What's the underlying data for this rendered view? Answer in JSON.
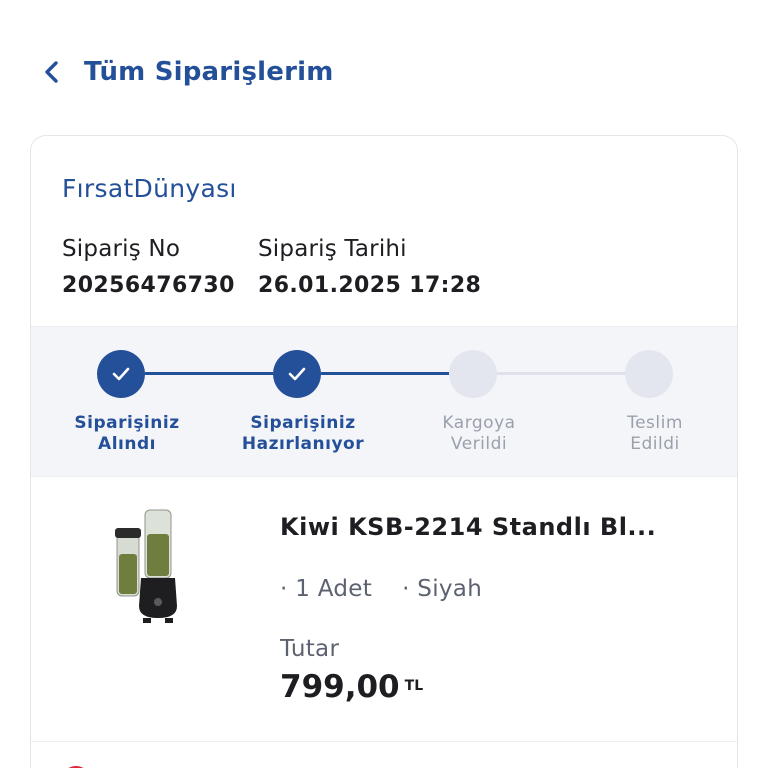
{
  "header": {
    "back_icon": "chevron-left-icon",
    "title": "Tüm Siparişlerim"
  },
  "order": {
    "seller": "FırsatDünyası",
    "number_label": "Sipariş No",
    "number_value": "20256476730",
    "date_label": "Sipariş Tarihi",
    "date_value": "26.01.2025 17:28"
  },
  "steps": [
    {
      "line1": "Siparişiniz",
      "line2": "Alındı",
      "status": "done"
    },
    {
      "line1": "Siparişiniz",
      "line2": "Hazırlanıyor",
      "status": "done"
    },
    {
      "line1": "Kargoya",
      "line2": "Verildi",
      "status": "pending"
    },
    {
      "line1": "Teslim",
      "line2": "Edildi",
      "status": "pending"
    }
  ],
  "product": {
    "title": "Kiwi KSB-2214 Standlı Bl...",
    "quantity": "· 1 Adet",
    "color": "· Siyah",
    "total_label": "Tutar",
    "price": "799,00",
    "currency": "TL"
  },
  "colors": {
    "accent": "#24509a",
    "pending": "#e3e6ee",
    "alert": "#e0283c"
  }
}
